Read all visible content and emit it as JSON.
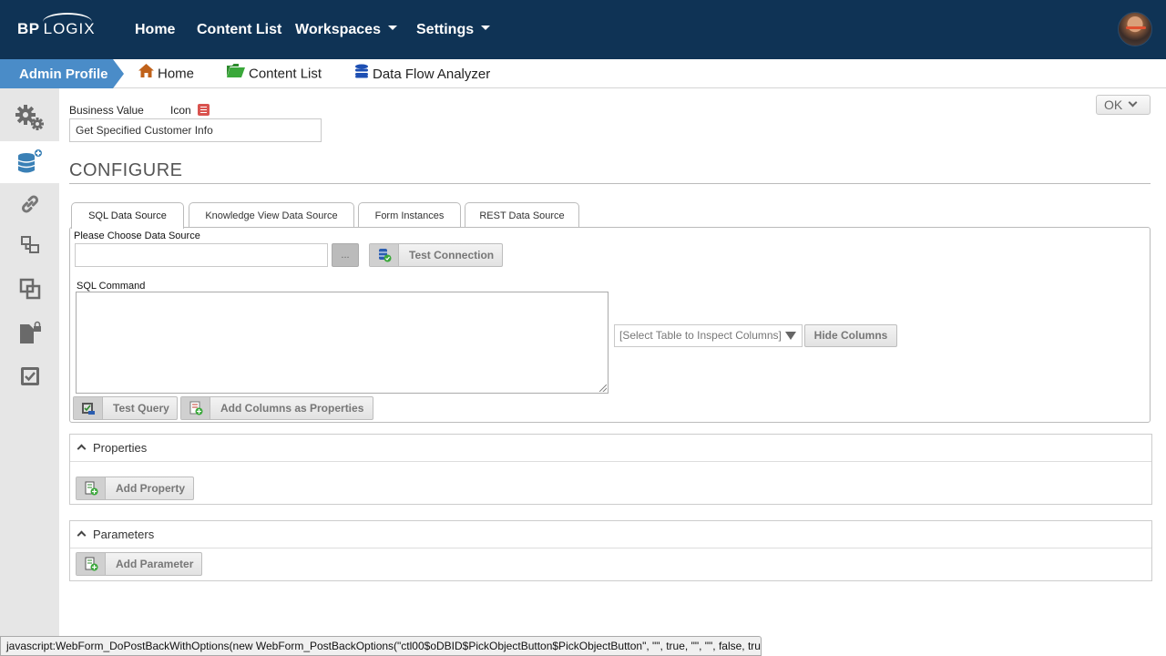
{
  "brand": {
    "logo_bp": "BP",
    "logo_logix": "LOGIX"
  },
  "topnav": {
    "items": [
      {
        "label": "Home"
      },
      {
        "label": "Content List"
      },
      {
        "label": "Workspaces"
      },
      {
        "label": "Settings"
      }
    ]
  },
  "subbar": {
    "active_label": "Admin Profile",
    "links": [
      {
        "label": "Home",
        "icon": "home-icon"
      },
      {
        "label": "Content List",
        "icon": "folder-open-icon"
      },
      {
        "label": "Data Flow Analyzer",
        "icon": "database-icon"
      }
    ]
  },
  "sidebar": {
    "items": [
      {
        "icon": "gears-icon"
      },
      {
        "icon": "database-add-icon",
        "active": true
      },
      {
        "icon": "link-icon"
      },
      {
        "icon": "hierarchy-icon"
      },
      {
        "icon": "copy-icon"
      },
      {
        "icon": "locked-document-icon"
      },
      {
        "icon": "checklist-icon"
      }
    ]
  },
  "form": {
    "business_value_label": "Business Value",
    "icon_label": "Icon",
    "business_value": "Get Specified Customer Info",
    "ok_label": "OK",
    "configure_title": "CONFIGURE"
  },
  "tabs": [
    {
      "label": "SQL Data Source",
      "active": true
    },
    {
      "label": "Knowledge View Data Source"
    },
    {
      "label": "Form Instances"
    },
    {
      "label": "REST Data Source"
    }
  ],
  "sql_panel": {
    "choose_label": "Please Choose Data Source",
    "ellipsis_label": "...",
    "test_connection_label": "Test Connection",
    "sql_command_label": "SQL Command",
    "select_table_placeholder": "[Select Table to Inspect Columns]",
    "hide_columns_label": "Hide Columns",
    "test_query_label": "Test Query",
    "add_columns_label": "Add Columns as Properties"
  },
  "properties": {
    "title": "Properties",
    "add_label": "Add Property"
  },
  "parameters": {
    "title": "Parameters",
    "add_label": "Add Parameter"
  },
  "statusbar": {
    "text": "javascript:WebForm_DoPostBackWithOptions(new WebForm_PostBackOptions(\"ctl00$oDBID$PickObjectButton$PickObjectButton\", \"\", true, \"\", \"\", false, true))"
  },
  "colors": {
    "topnav_bg": "#0f3355",
    "accent_blue": "#4a8cc8",
    "sidebar_bg": "#e6e6e6",
    "icon_red": "#d9534f"
  }
}
